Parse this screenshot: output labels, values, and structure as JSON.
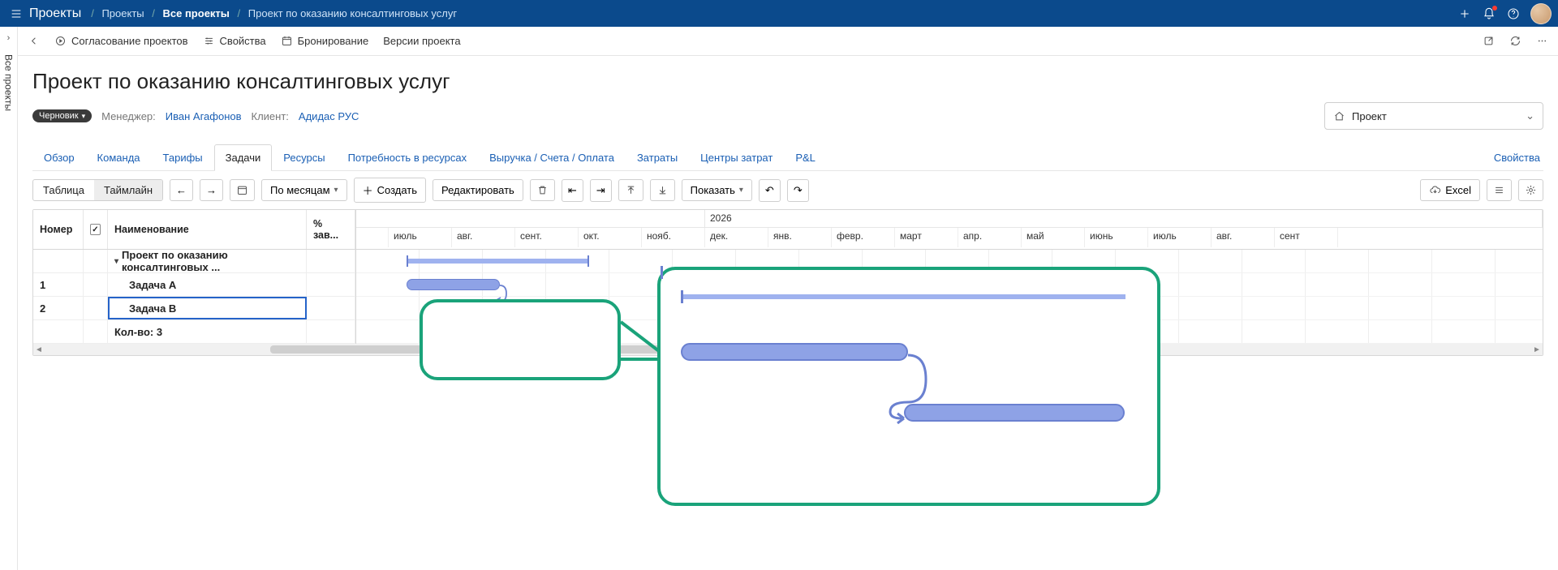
{
  "topbar": {
    "brand": "Проекты",
    "crumbs": [
      {
        "label": "Проекты",
        "strong": false
      },
      {
        "label": "Все проекты",
        "strong": true
      },
      {
        "label": "Проект по оказанию консалтинговых услуг",
        "strong": false
      }
    ]
  },
  "leftrail": {
    "label": "Все проекты"
  },
  "actionbar": {
    "approve": "Согласование проектов",
    "props": "Свойства",
    "booking": "Бронирование",
    "versions": "Версии проекта"
  },
  "page": {
    "title": "Проект по оказанию консалтинговых услуг",
    "status_chip": "Черновик",
    "manager_label": "Менеджер:",
    "manager_value": "Иван Агафонов",
    "client_label": "Клиент:",
    "client_value": "Адидас РУС",
    "view_selector": "Проект"
  },
  "tabs": {
    "items": [
      "Обзор",
      "Команда",
      "Тарифы",
      "Задачи",
      "Ресурсы",
      "Потребность в ресурсах",
      "Выручка / Счета / Оплата",
      "Затраты",
      "Центры затрат",
      "P&L"
    ],
    "active_index": 3,
    "right_link": "Свойства"
  },
  "toolbar": {
    "seg_table": "Таблица",
    "seg_timeline": "Таймлайн",
    "period_label": "По месяцам",
    "create": "Создать",
    "edit": "Редактировать",
    "show": "Показать",
    "excel": "Excel"
  },
  "grid": {
    "headers": {
      "num": "Номер",
      "name": "Наименование",
      "pct": "% зав..."
    },
    "year_right": "2026",
    "months": [
      "июль",
      "авг.",
      "сент.",
      "окт.",
      "нояб.",
      "дек.",
      "янв.",
      "февр.",
      "март",
      "апр.",
      "май",
      "июнь",
      "июль",
      "авг.",
      "сент"
    ],
    "rows": [
      {
        "num": "",
        "name": "Проект по оказанию консалтинговых ...",
        "is_group": true
      },
      {
        "num": "1",
        "name": "Задача А",
        "is_group": false
      },
      {
        "num": "2",
        "name": "Задача B",
        "is_group": false,
        "selected": true
      }
    ],
    "footer": "Кол-во: 3"
  }
}
